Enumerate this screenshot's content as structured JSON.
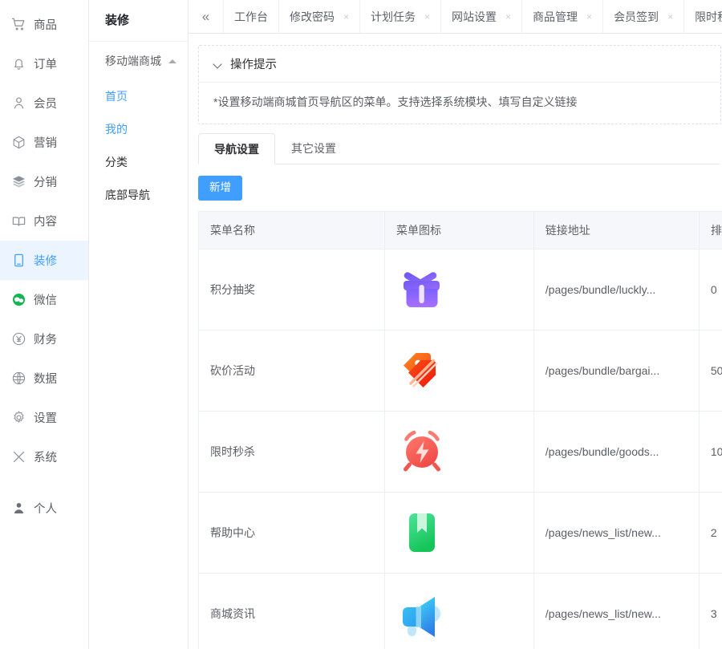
{
  "sidebar": {
    "items": [
      {
        "label": "商品",
        "icon": "cart-icon",
        "active": false
      },
      {
        "label": "订单",
        "icon": "bell-icon",
        "active": false
      },
      {
        "label": "会员",
        "icon": "user-icon",
        "active": false
      },
      {
        "label": "营销",
        "icon": "cube-icon",
        "active": false
      },
      {
        "label": "分销",
        "icon": "layers-icon",
        "active": false
      },
      {
        "label": "内容",
        "icon": "book-icon",
        "active": false
      },
      {
        "label": "装修",
        "icon": "mobile-icon",
        "active": true
      },
      {
        "label": "微信",
        "icon": "wechat-icon",
        "active": false
      },
      {
        "label": "财务",
        "icon": "yuan-circle-icon",
        "active": false
      },
      {
        "label": "数据",
        "icon": "globe-icon",
        "active": false
      },
      {
        "label": "设置",
        "icon": "gear-icon",
        "active": false
      },
      {
        "label": "系统",
        "icon": "tools-icon",
        "active": false
      },
      {
        "label": "个人",
        "icon": "person-icon",
        "active": false
      }
    ]
  },
  "subpanel": {
    "title": "装修",
    "group_label": "移动端商城",
    "group_caret": "chevron-up-icon",
    "items": [
      {
        "label": "首页",
        "highlight": true
      },
      {
        "label": "我的",
        "highlight": true
      },
      {
        "label": "分类",
        "highlight": false
      },
      {
        "label": "底部导航",
        "highlight": false
      }
    ]
  },
  "tabbar": {
    "collapse_icon": "«",
    "tabs": [
      {
        "label": "工作台",
        "closable": false
      },
      {
        "label": "修改密码",
        "closable": true
      },
      {
        "label": "计划任务",
        "closable": true
      },
      {
        "label": "网站设置",
        "closable": true
      },
      {
        "label": "商品管理",
        "closable": true
      },
      {
        "label": "会员签到",
        "closable": true
      },
      {
        "label": "限时秒杀",
        "closable": true
      }
    ],
    "close_glyph": "×"
  },
  "tips": {
    "title": "操作提示",
    "body": "*设置移动端商城首页导航区的菜单。支持选择系统模块、填写自定义链接"
  },
  "inner_tabs": [
    {
      "label": "导航设置",
      "active": true
    },
    {
      "label": "其它设置",
      "active": false
    }
  ],
  "toolbar": {
    "add_label": "新增"
  },
  "table": {
    "columns": [
      "菜单名称",
      "菜单图标",
      "链接地址",
      "排序"
    ],
    "rows": [
      {
        "name": "积分抽奖",
        "icon": "gift-box-icon",
        "url": "/pages/bundle/luckly...",
        "sort": "0"
      },
      {
        "name": "砍价活动",
        "icon": "price-tags-icon",
        "url": "/pages/bundle/bargai...",
        "sort": "50"
      },
      {
        "name": "限时秒杀",
        "icon": "alarm-clock-icon",
        "url": "/pages/bundle/goods...",
        "sort": "10"
      },
      {
        "name": "帮助中心",
        "icon": "bookmark-icon",
        "url": "/pages/news_list/new...",
        "sort": "2"
      },
      {
        "name": "商城资讯",
        "icon": "megaphone-icon",
        "url": "/pages/news_list/new...",
        "sort": "3"
      }
    ]
  },
  "colors": {
    "accent": "#409eff",
    "active_bg": "#ecf5ff",
    "header_bg": "#f5f7fa",
    "border": "#ebeef5"
  }
}
